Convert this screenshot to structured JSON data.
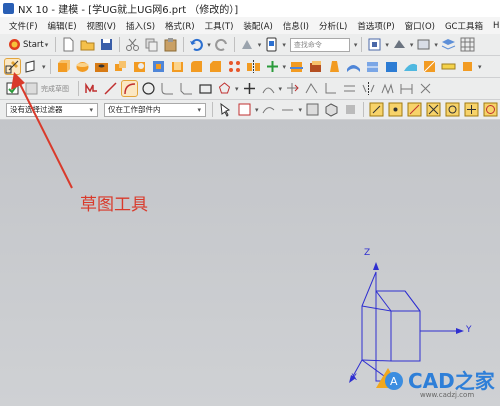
{
  "window": {
    "title": "NX 10 - 建模 - [学UG就上UG网6.prt  （修改的）]"
  },
  "menubar": {
    "items": [
      "文件(F)",
      "编辑(E)",
      "视图(V)",
      "插入(S)",
      "格式(R)",
      "工具(T)",
      "装配(A)",
      "信息(I)",
      "分析(L)",
      "首选项(P)",
      "窗口(O)",
      "GC工具箱",
      "HB_MC"
    ]
  },
  "toolbar": {
    "start_label": "Start",
    "search_placeholder": "查找命令"
  },
  "sketch_toolbar": {
    "finish_label": "完成草图"
  },
  "selection_bar": {
    "filter_value": "没有选择过滤器",
    "scope_value": "仅在工作部件内"
  },
  "annotation": {
    "text": "草图工具",
    "color": "#d93a2b"
  },
  "watermark": {
    "brand": "CAD之家",
    "url": "www.cadzj.com"
  },
  "axes": {
    "z": "Z",
    "y": "Y",
    "x": "X",
    "color": "#2f2fd0"
  },
  "icons": [
    "nx-logo-icon",
    "start-icon",
    "new-file-icon",
    "open-folder-icon",
    "save-icon",
    "cut-icon",
    "copy-icon",
    "paste-icon",
    "undo-icon",
    "redo-icon",
    "sketch-icon",
    "arc-icon",
    "line-icon",
    "circle-icon"
  ]
}
